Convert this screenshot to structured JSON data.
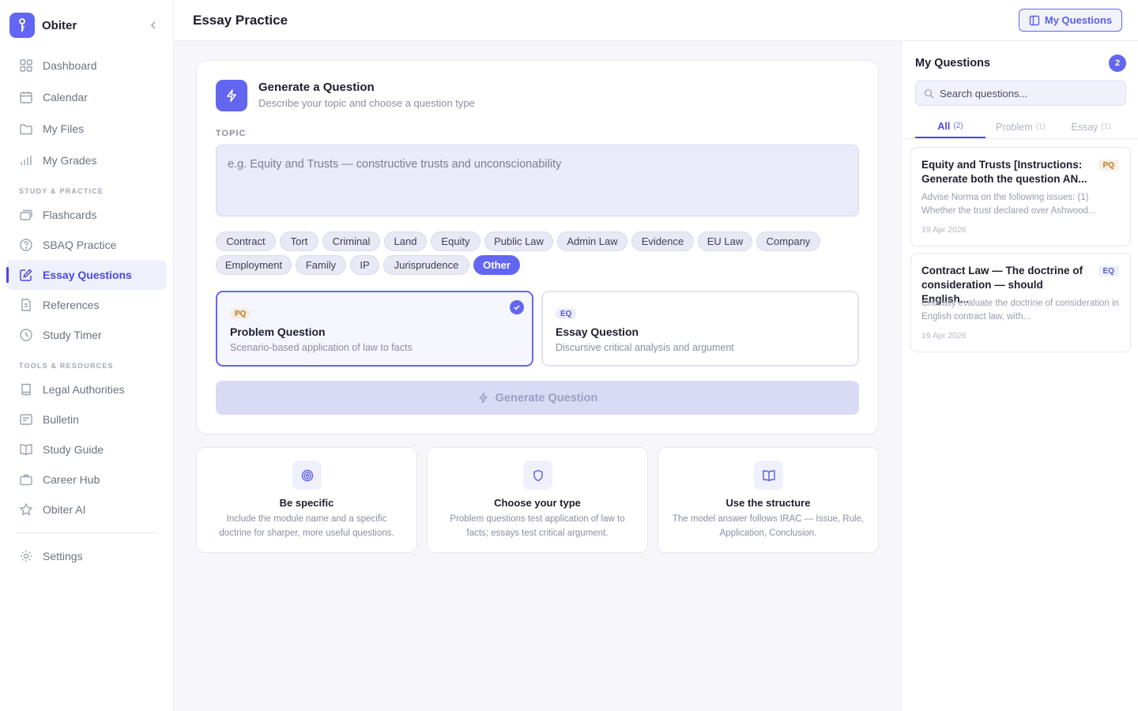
{
  "app": {
    "name": "Obiter"
  },
  "sidebar": {
    "items_top": [
      {
        "label": "Dashboard",
        "icon": "grid-icon"
      },
      {
        "label": "Calendar",
        "icon": "calendar-icon"
      },
      {
        "label": "My Files",
        "icon": "folder-icon"
      },
      {
        "label": "My Grades",
        "icon": "bar-chart-icon"
      }
    ],
    "section_study": "STUDY & PRACTICE",
    "items_study": [
      {
        "label": "Flashcards",
        "icon": "cards-icon"
      },
      {
        "label": "SBAQ Practice",
        "icon": "question-circle-icon"
      },
      {
        "label": "Essay Questions",
        "icon": "edit-icon",
        "active": true
      },
      {
        "label": "References",
        "icon": "document-icon"
      },
      {
        "label": "Study Timer",
        "icon": "clock-icon"
      }
    ],
    "section_tools": "TOOLS & RESOURCES",
    "items_tools": [
      {
        "label": "Legal Authorities",
        "icon": "book-icon"
      },
      {
        "label": "Bulletin",
        "icon": "bulletin-icon"
      },
      {
        "label": "Study Guide",
        "icon": "open-book-icon"
      },
      {
        "label": "Career Hub",
        "icon": "briefcase-icon"
      },
      {
        "label": "Obiter AI",
        "icon": "star-icon"
      }
    ],
    "settings_label": "Settings"
  },
  "header": {
    "title": "Essay Practice",
    "my_questions_label": "My Questions"
  },
  "generator": {
    "title": "Generate a Question",
    "subtitle": "Describe your topic and choose a question type",
    "topic_label": "TOPIC",
    "topic_placeholder": "e.g. Equity and Trusts — constructive trusts and unconscionability",
    "topic_value": "",
    "chips": [
      "Contract",
      "Tort",
      "Criminal",
      "Land",
      "Equity",
      "Public Law",
      "Admin Law",
      "Evidence",
      "EU Law",
      "Company",
      "Employment",
      "Family",
      "IP",
      "Jurisprudence",
      "Other"
    ],
    "selected_chip": "Other",
    "types": [
      {
        "badge": "PQ",
        "title": "Problem Question",
        "subtitle": "Scenario-based application of law to facts",
        "selected": true
      },
      {
        "badge": "EQ",
        "title": "Essay Question",
        "subtitle": "Discursive critical analysis and argument",
        "selected": false
      }
    ],
    "generate_label": "Generate Question"
  },
  "tips": [
    {
      "title": "Be specific",
      "text": "Include the module name and a specific doctrine for sharper, more useful questions.",
      "icon": "target-icon"
    },
    {
      "title": "Choose your type",
      "text": "Problem questions test application of law to facts; essays test critical argument.",
      "icon": "shield-icon"
    },
    {
      "title": "Use the structure",
      "text": "The model answer follows IRAC — Issue, Rule, Application, Conclusion.",
      "icon": "open-book-icon"
    }
  ],
  "panel": {
    "title": "My Questions",
    "count": "2",
    "search_placeholder": "Search questions...",
    "tabs": [
      {
        "label": "All",
        "count": "(2)",
        "active": true
      },
      {
        "label": "Problem",
        "count": "(1)",
        "active": false
      },
      {
        "label": "Essay",
        "count": "(1)",
        "active": false
      }
    ],
    "questions": [
      {
        "title": "Equity and Trusts [Instructions: Generate both the question AN...",
        "badge": "PQ",
        "snippet": "Advise Norma on the following issues: (1) Whether the trust declared over Ashwood...",
        "date": "19 Apr 2026"
      },
      {
        "title": "Contract Law — The doctrine of consideration — should English...",
        "badge": "EQ",
        "snippet": "Critically evaluate the doctrine of consideration in English contract law, with...",
        "date": "19 Apr 2026"
      }
    ]
  },
  "colors": {
    "accent": "#6366f1",
    "pq": "#c2751a",
    "eq": "#5457d4"
  }
}
